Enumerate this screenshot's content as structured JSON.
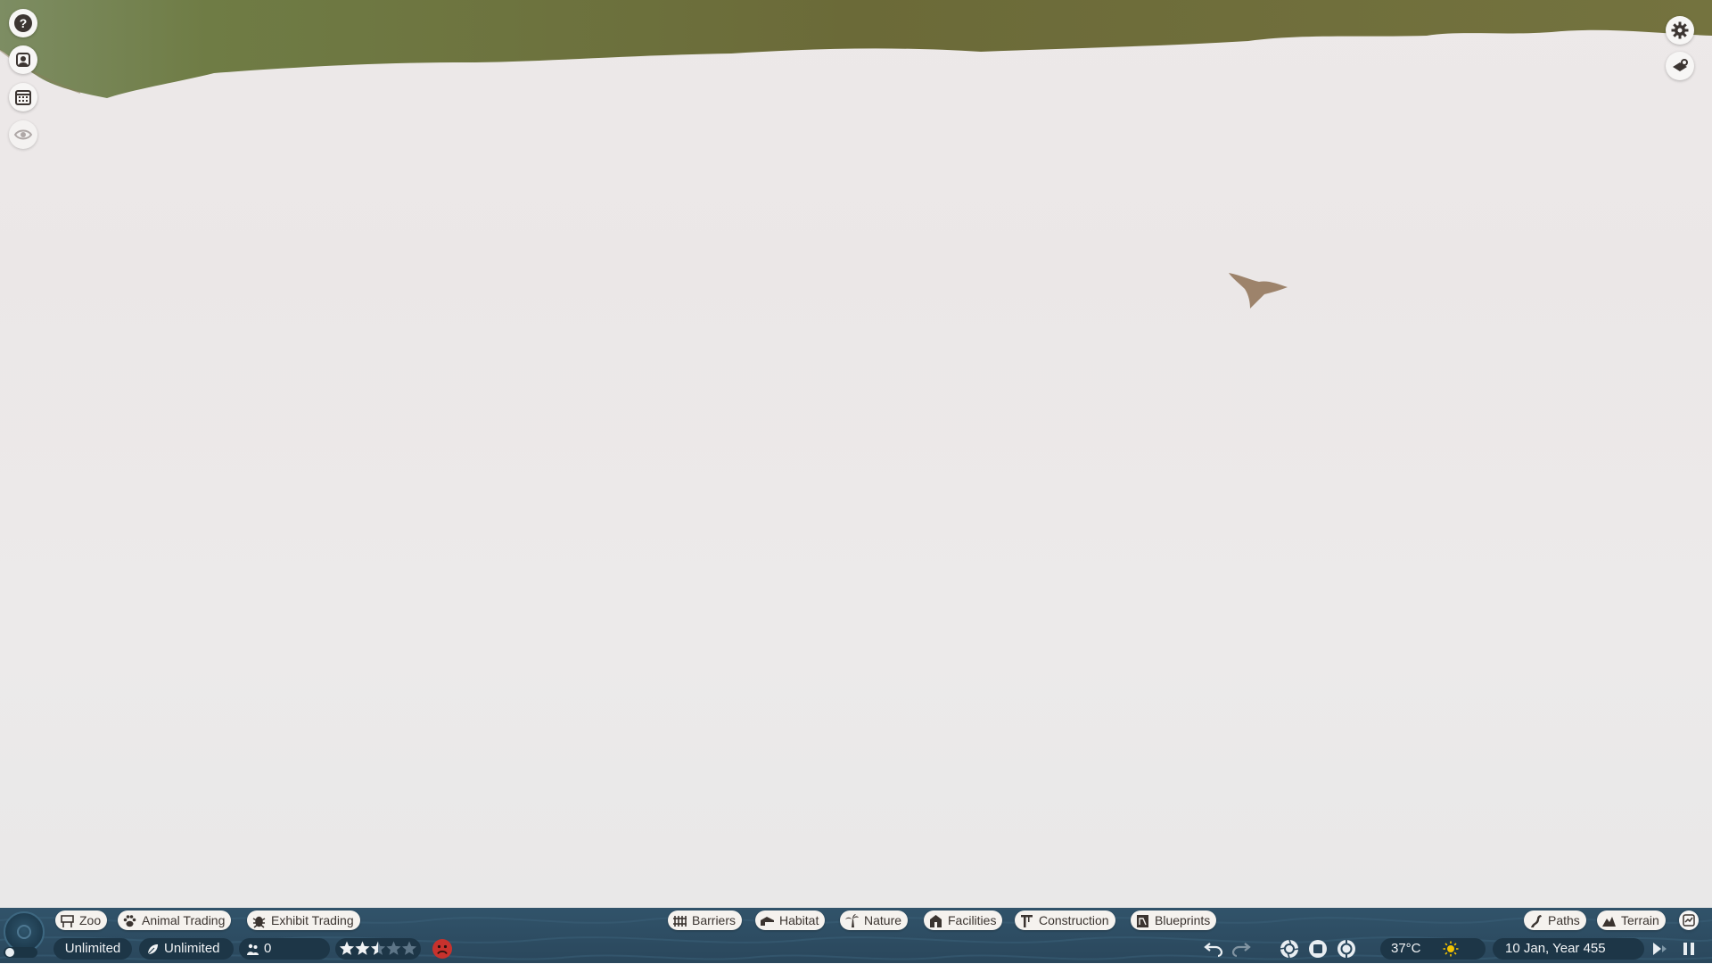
{
  "left_sidebar": {
    "items": [
      {
        "name": "help-icon"
      },
      {
        "name": "zookeeper-icon"
      },
      {
        "name": "calendar-icon"
      },
      {
        "name": "visibility-eye-icon"
      }
    ]
  },
  "right_sidebar": {
    "items": [
      {
        "name": "settings-gear-icon"
      },
      {
        "name": "camera-icon"
      }
    ]
  },
  "toolbar_left": {
    "zoo_label": "Zoo",
    "animal_trading_label": "Animal Trading",
    "exhibit_trading_label": "Exhibit Trading"
  },
  "toolbar_center": {
    "barriers_label": "Barriers",
    "habitat_label": "Habitat",
    "nature_label": "Nature",
    "facilities_label": "Facilities",
    "construction_label": "Construction",
    "blueprints_label": "Blueprints"
  },
  "toolbar_right": {
    "paths_label": "Paths",
    "terrain_label": "Terrain"
  },
  "status_bar": {
    "money": "Unlimited",
    "conservation_credits": "Unlimited",
    "guests": "0",
    "zoo_rating_stars": 2.5,
    "rating_max": 5,
    "guest_mood": "unhappy",
    "temperature": "37°C",
    "weather": "sunny",
    "date": "10 Jan, Year 455"
  },
  "colors": {
    "hud_bg": "#2d4b60",
    "pill_bg": "#f5f2ee",
    "pill_text": "#3b3430",
    "mood_red": "#c8322d",
    "sun_yellow": "#f2c200",
    "grass_green": "#6b6a3a",
    "snow": "#ece8e8"
  }
}
